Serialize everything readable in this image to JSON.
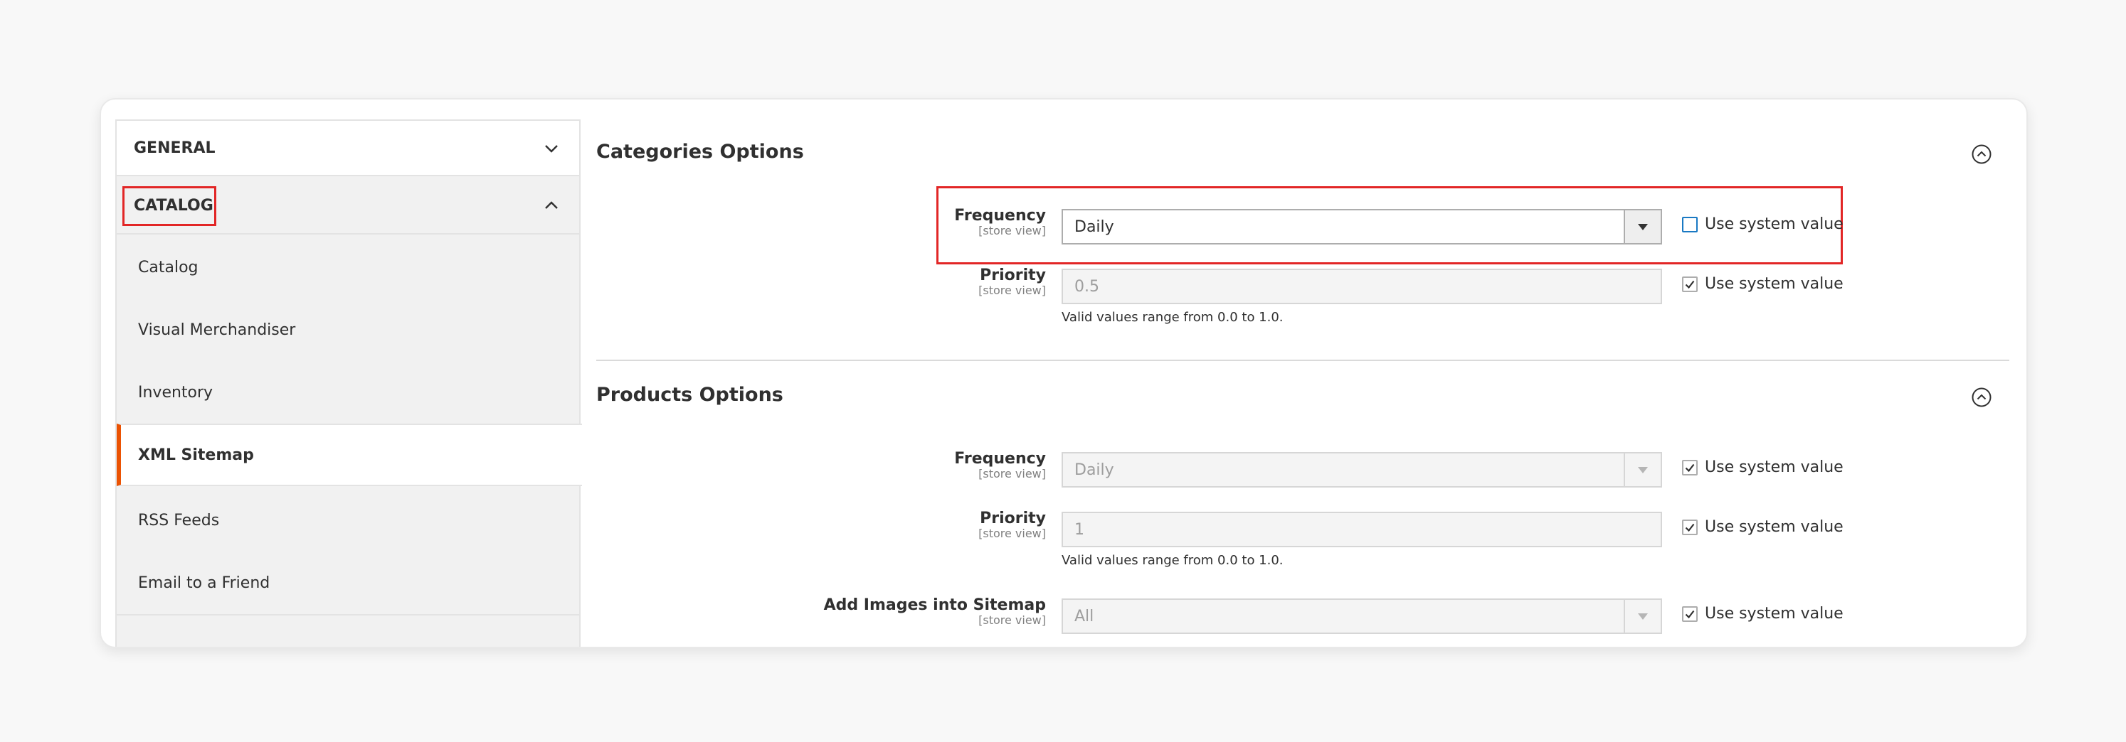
{
  "sidebar": {
    "general_label": "GENERAL",
    "catalog_label": "CATALOG",
    "items": [
      {
        "label": "Catalog"
      },
      {
        "label": "Visual Merchandiser"
      },
      {
        "label": "Inventory"
      },
      {
        "label": "XML Sitemap",
        "active": true
      },
      {
        "label": "RSS Feeds"
      },
      {
        "label": "Email to a Friend"
      }
    ]
  },
  "categories": {
    "title": "Categories Options",
    "frequency": {
      "label": "Frequency",
      "scope": "[store view]",
      "value": "Daily",
      "use_system": "Use system value",
      "checked": false
    },
    "priority": {
      "label": "Priority",
      "scope": "[store view]",
      "value": "0.5",
      "note": "Valid values range from 0.0 to 1.0.",
      "use_system": "Use system value",
      "checked": true
    }
  },
  "products": {
    "title": "Products Options",
    "frequency": {
      "label": "Frequency",
      "scope": "[store view]",
      "value": "Daily",
      "use_system": "Use system value",
      "checked": true
    },
    "priority": {
      "label": "Priority",
      "scope": "[store view]",
      "value": "1",
      "note": "Valid values range from 0.0 to 1.0.",
      "use_system": "Use system value",
      "checked": true
    },
    "images": {
      "label": "Add Images into Sitemap",
      "scope": "[store view]",
      "value": "All",
      "use_system": "Use system value",
      "checked": true
    }
  },
  "colors": {
    "accent": "#eb5202",
    "highlight": "#e22626",
    "checkbox_focus": "#1979c3"
  },
  "icons": [
    "chevron-down-icon",
    "chevron-up-icon",
    "collapse-circle-icon",
    "dropdown-arrow-icon",
    "checkmark-icon"
  ]
}
